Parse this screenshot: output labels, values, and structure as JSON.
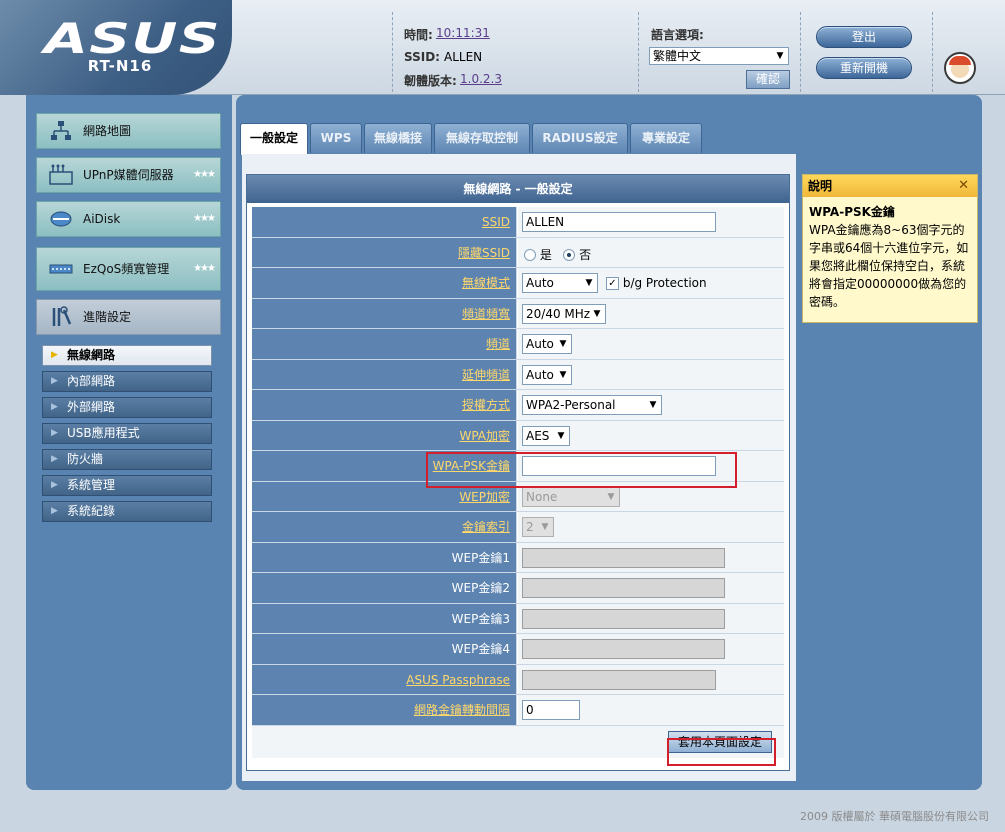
{
  "header": {
    "brand": "ASUS",
    "model": "RT-N16",
    "time_label": "時間:",
    "time_value": "10:11:31",
    "ssid_label": "SSID:",
    "ssid_value": "ALLEN",
    "firmware_label": "韌體版本:",
    "firmware_value": "1.0.2.3",
    "language_label": "語言選項:",
    "language_value": "繁體中文",
    "confirm_label": "確認",
    "logout_label": "登出",
    "reboot_label": "重新開機"
  },
  "sidebar": {
    "main_items": [
      {
        "label": "網路地圖",
        "icon": "network-map-icon"
      },
      {
        "label": "UPnP媒體伺服器",
        "icon": "media-server-icon"
      },
      {
        "label": "AiDisk",
        "icon": "aidisk-icon"
      },
      {
        "label": "EzQoS頻寬管理",
        "icon": "qos-icon"
      },
      {
        "label": "進階設定",
        "icon": "tools-icon"
      }
    ],
    "sub_items": [
      {
        "label": "無線網路"
      },
      {
        "label": "內部網路"
      },
      {
        "label": "外部網路"
      },
      {
        "label": "USB應用程式"
      },
      {
        "label": "防火牆"
      },
      {
        "label": "系統管理"
      },
      {
        "label": "系統紀錄"
      }
    ]
  },
  "tabs": [
    {
      "label": "一般設定"
    },
    {
      "label": "WPS"
    },
    {
      "label": "無線橋接"
    },
    {
      "label": "無線存取控制"
    },
    {
      "label": "RADIUS設定"
    },
    {
      "label": "專業設定"
    }
  ],
  "form": {
    "title": "無線網路 - 一般設定",
    "rows": [
      {
        "label": "SSID",
        "value": "ALLEN"
      },
      {
        "label": "隱藏SSID",
        "yes": "是",
        "no": "否"
      },
      {
        "label": "無線模式",
        "value": "Auto",
        "checkbox_label": "b/g Protection"
      },
      {
        "label": "頻道頻寬",
        "value": "20/40 MHz"
      },
      {
        "label": "頻道",
        "value": "Auto"
      },
      {
        "label": "延伸頻道",
        "value": "Auto"
      },
      {
        "label": "授權方式",
        "value": "WPA2-Personal"
      },
      {
        "label": "WPA加密",
        "value": "AES"
      },
      {
        "label": "WPA-PSK金鑰",
        "value": ""
      },
      {
        "label": "WEP加密",
        "value": "None"
      },
      {
        "label": "金鑰索引",
        "value": "2"
      },
      {
        "label": "WEP金鑰1",
        "value": ""
      },
      {
        "label": "WEP金鑰2",
        "value": ""
      },
      {
        "label": "WEP金鑰3",
        "value": ""
      },
      {
        "label": "WEP金鑰4",
        "value": ""
      },
      {
        "label": "ASUS Passphrase",
        "value": ""
      },
      {
        "label": "網路金鑰轉動間隔",
        "value": "0"
      }
    ],
    "apply_label": "套用本頁面設定"
  },
  "help": {
    "title": "說明",
    "close": "✕",
    "heading": "WPA-PSK金鑰",
    "body": "WPA金鑰應為8~63個字元的字串或64個十六進位字元，如果您將此欄位保持空白，系統將會指定00000000做為您的密碼。"
  },
  "footer": {
    "copyright": "2009 版權屬於 華碩電腦股份有限公司"
  }
}
